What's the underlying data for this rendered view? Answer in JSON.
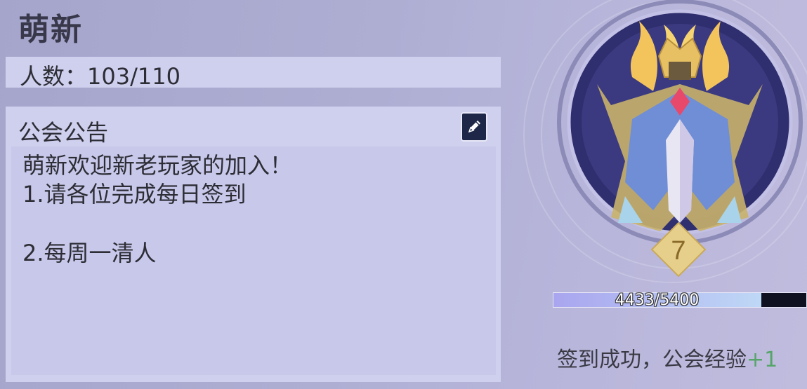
{
  "guild": {
    "name": "萌新",
    "members_label": "人数：103/110",
    "members_current": 103,
    "members_max": 110
  },
  "notice": {
    "title": "公会公告",
    "lines": [
      "萌新欢迎新老玩家的加入！",
      "1.请各位完成每日签到",
      "2.每周一清人"
    ],
    "edit_icon": "pencil-edit-icon"
  },
  "emblem": {
    "level": "7",
    "icon": "guild-crest-icon"
  },
  "experience": {
    "label": "4433/5400",
    "current": 4433,
    "max": 5400,
    "fraction": 0.821
  },
  "signin": {
    "message": "签到成功，公会经验",
    "gain": "+1"
  },
  "colors": {
    "panel": "#cfcfee",
    "xp_fill": "#b6c3f3",
    "gain_green": "#57a46a",
    "emblem_gold": "#e8c064"
  }
}
